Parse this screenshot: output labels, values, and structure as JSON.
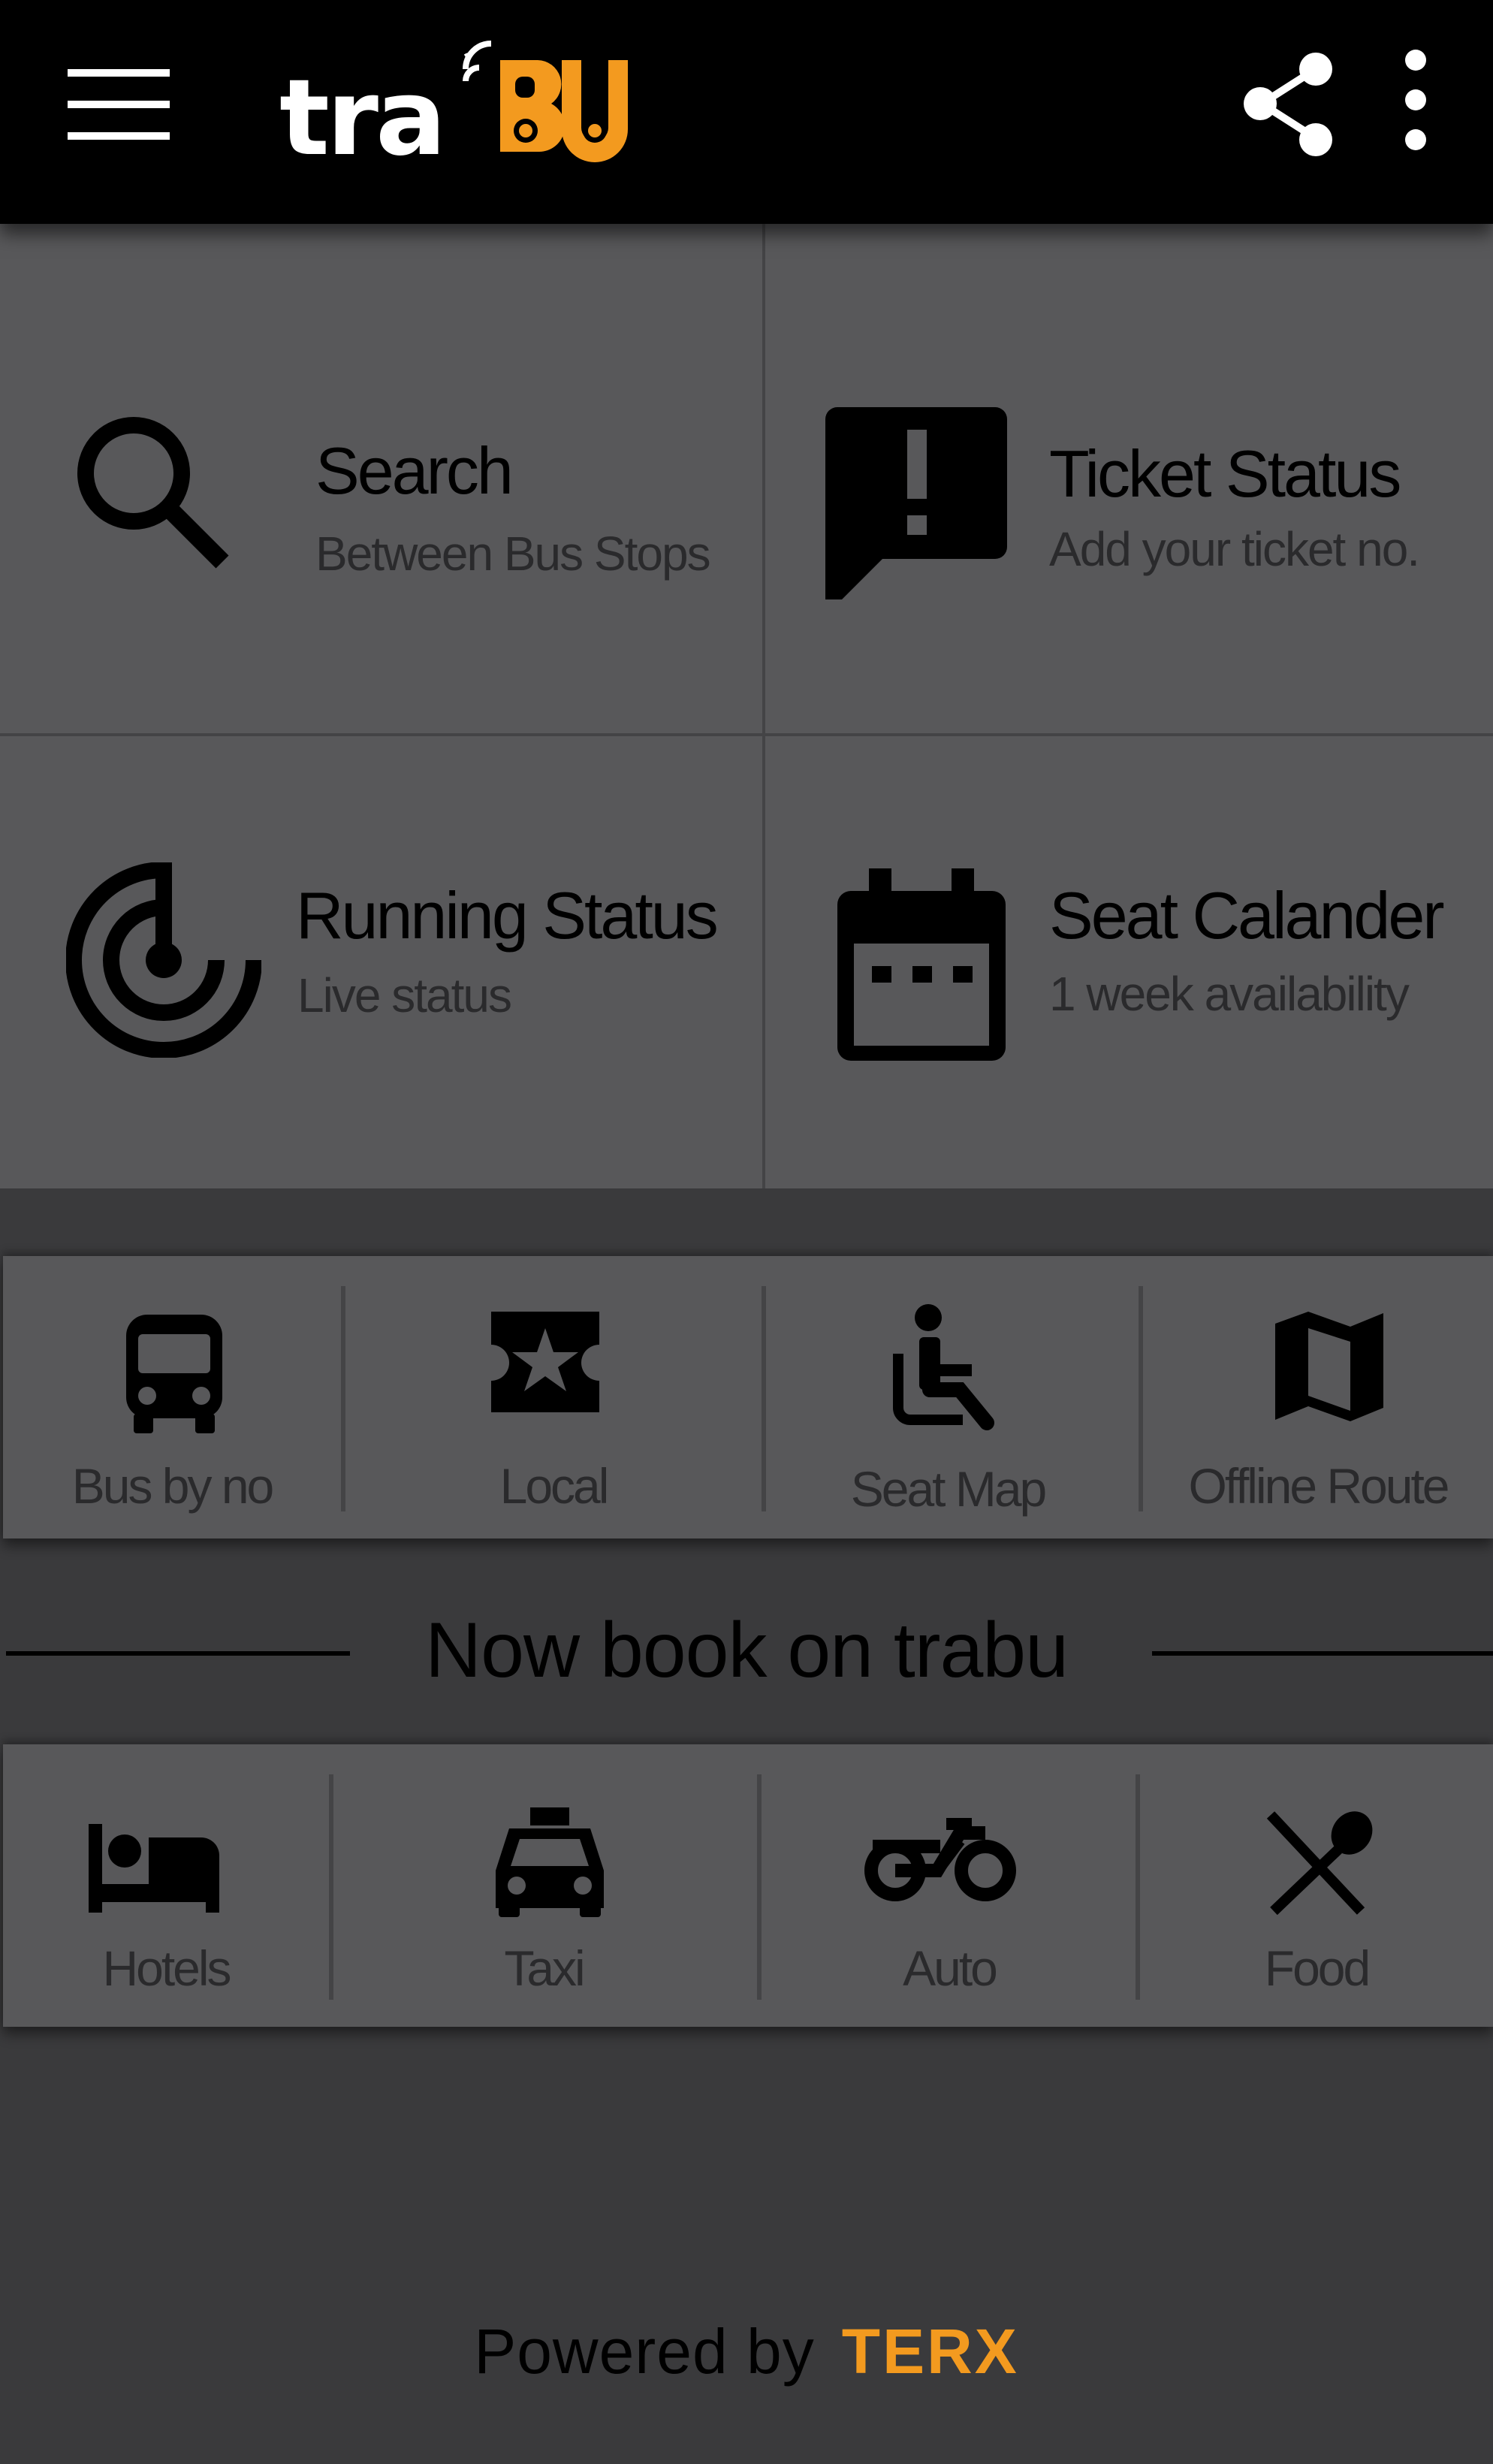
{
  "app": {
    "logo_text_white": "tra",
    "logo_text_orange": "BU",
    "accent_color": "#f39a1f",
    "toolbar_icons": [
      "menu-icon",
      "share-icon",
      "more-vert-icon"
    ]
  },
  "tiles": [
    {
      "title": "Search",
      "subtitle": "Between Bus Stops",
      "icon": "search-icon"
    },
    {
      "title": "Ticket Status",
      "subtitle": "Add your ticket no.",
      "icon": "feedback-alert-icon"
    },
    {
      "title": "Running Status",
      "subtitle": "Live status",
      "icon": "radar-icon"
    },
    {
      "title": "Seat Calander",
      "subtitle": "1 week availability",
      "icon": "calendar-icon"
    }
  ],
  "quick_actions": [
    {
      "label": "Bus by no",
      "icon": "bus-icon"
    },
    {
      "label": "Local",
      "icon": "ticket-star-icon"
    },
    {
      "label": "Seat Map",
      "icon": "wheelchair-seat-icon"
    },
    {
      "label": "Offline Route",
      "icon": "map-icon"
    }
  ],
  "booking": {
    "heading": "Now book on trabu",
    "items": [
      {
        "label": "Hotels",
        "icon": "hotel-bed-icon"
      },
      {
        "label": "Taxi",
        "icon": "taxi-icon"
      },
      {
        "label": "Auto",
        "icon": "motorcycle-icon"
      },
      {
        "label": "Food",
        "icon": "restaurant-icon"
      }
    ]
  },
  "footer": {
    "prefix": "Powered by",
    "brand": "TERX"
  }
}
